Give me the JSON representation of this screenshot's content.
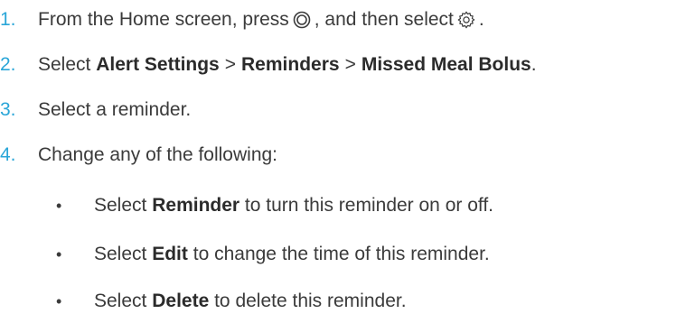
{
  "steps": [
    {
      "number": "1.",
      "text_a": "From the Home screen, press",
      "text_b": ", and then select",
      "text_c": ".",
      "icons": [
        "select-button-icon",
        "settings-gear-icon"
      ]
    },
    {
      "number": "2.",
      "prefix": "Select",
      "path": [
        "Alert Settings",
        "Reminders",
        "Missed Meal Bolus"
      ],
      "separator": ">",
      "suffix": "."
    },
    {
      "number": "3.",
      "text": "Select a reminder."
    },
    {
      "number": "4.",
      "text": "Change any of the following:"
    }
  ],
  "bullets": [
    {
      "marker": "•",
      "prefix": "Select",
      "term": "Reminder",
      "rest": "to turn this reminder on or off."
    },
    {
      "marker": "•",
      "prefix": "Select",
      "term": "Edit",
      "rest": "to change the time of this reminder."
    },
    {
      "marker": "•",
      "prefix": "Select",
      "term": "Delete",
      "rest": "to delete this reminder."
    }
  ],
  "colors": {
    "step_number": "#2aa6d8",
    "body_text": "#3b3b3b"
  }
}
